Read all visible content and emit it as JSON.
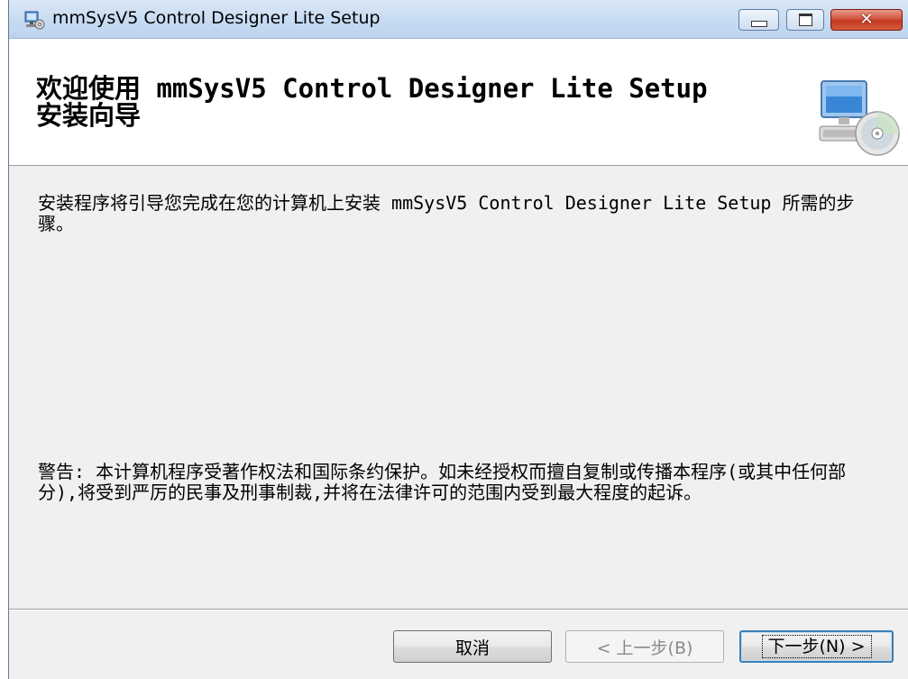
{
  "window": {
    "title": "mmSysV5 Control Designer Lite Setup"
  },
  "banner": {
    "heading_line1": "欢迎使用 mmSysV5 Control Designer Lite Setup",
    "heading_line2": "安装向导",
    "icon": "computer-cd-icon"
  },
  "content": {
    "intro": "安装程序将引导您完成在您的计算机上安装 mmSysV5 Control Designer Lite Setup 所需的步骤。",
    "warning": "警告: 本计算机程序受著作权法和国际条约保护。如未经授权而擅自复制或传播本程序(或其中任何部分),将受到严厉的民事及刑事制裁,并将在法律许可的范围内受到最大程度的起诉。"
  },
  "buttons": {
    "cancel": "取消",
    "back": "< 上一步(B)",
    "next": "下一步(N) >"
  },
  "colors": {
    "close_button": "#c33a22",
    "titlebar": "#c8dcf2",
    "body_bg": "#f0f0f0"
  }
}
